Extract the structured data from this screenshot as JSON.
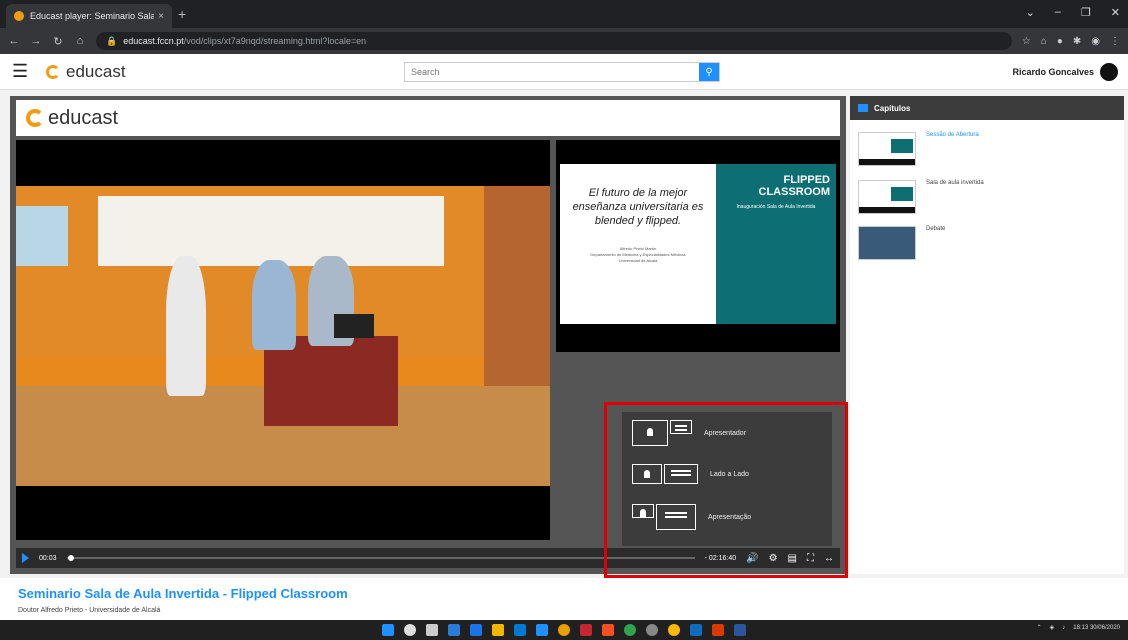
{
  "browser": {
    "tab_title": "Educast player: Seminario Sala d...",
    "url_domain": "educast.fccn.pt",
    "url_path": "/vod/clips/xt7a9nqd/streaming.html?locale=en",
    "new_tab": "+",
    "close_tab": "×"
  },
  "site": {
    "logo_text": "educast",
    "search_placeholder": "Search",
    "user_name": "Ricardo Goncalves"
  },
  "player": {
    "logo_text": "educast",
    "slide": {
      "headline": "El futuro de la mejor enseñanza universitaria es blended y flipped.",
      "author_lines": [
        "Alfredo Prieto Martín",
        "Departamento de Medicina y Especialidades Médicas",
        "Universidad de Alcalá"
      ],
      "poster_title": "FLIPPED CLASSROOM",
      "poster_sub": "Inauguración Sala de Aula Invertida"
    },
    "layout_menu": [
      {
        "label": "Apresentador"
      },
      {
        "label": "Lado a Lado"
      },
      {
        "label": "Apresentação"
      }
    ],
    "controls": {
      "current_time": "00:03",
      "remaining_time": "- 02:16:40",
      "progress": 0.002
    }
  },
  "chapters": {
    "header": "Capítulos",
    "items": [
      {
        "label": "Sessão de Abertura",
        "active": true
      },
      {
        "label": "Sala de aula invertida",
        "active": false
      },
      {
        "label": "Debate",
        "active": false
      }
    ]
  },
  "video": {
    "title": "Seminario Sala de Aula Invertida - Flipped Classroom",
    "author": "Doutor Alfredo Prieto - Universidade de Alcalá"
  },
  "taskbar": {
    "time": "18:13",
    "date": "30/06/2020"
  },
  "colors": {
    "accent": "#1e90ff",
    "brand_orange": "#f39c12",
    "highlight_red": "#e00000"
  }
}
